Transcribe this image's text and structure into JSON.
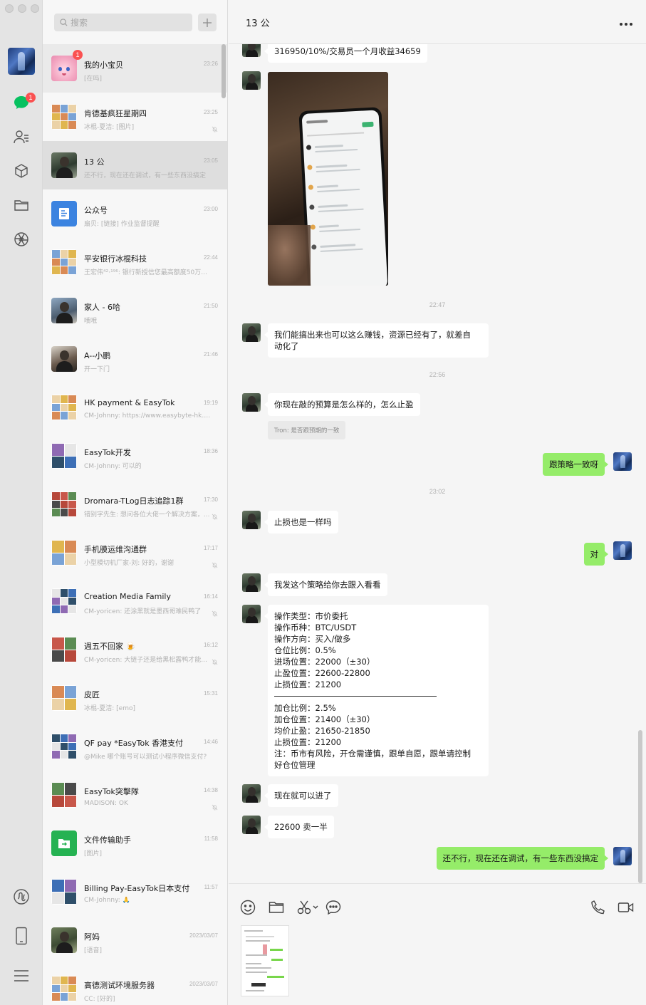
{
  "iconbar": {
    "chat_badge": "1"
  },
  "search": {
    "placeholder": "搜索"
  },
  "chats": [
    {
      "name": "我的小宝贝",
      "preview": "[在吗]",
      "time": "23:26",
      "badge": "1",
      "muted": false,
      "avatar": "pink-character"
    },
    {
      "name": "肯德基疯狂星期四",
      "preview": "冰棍-夏洁: [图片]",
      "time": "23:25",
      "muted": true,
      "avatar": "group"
    },
    {
      "name": "13 公",
      "preview": "还不行，现在还在调试，有一些东西没搞定",
      "time": "23:05",
      "muted": false,
      "avatar": "person"
    },
    {
      "name": "公众号",
      "preview": "扇贝: [链接] 作业监督提醒",
      "time": "23:00",
      "muted": false,
      "avatar": "official"
    },
    {
      "name": "平安银行冰棍科技",
      "preview": "王宏伟⁴²·¹⁹⁶: 银行新授信您最高额度50万...",
      "time": "22:44",
      "muted": false,
      "avatar": "group"
    },
    {
      "name": "家人 - 6哈",
      "preview": "哦哦",
      "time": "21:50",
      "muted": false,
      "avatar": "person2"
    },
    {
      "name": "A--小鹏",
      "preview": "开一下门",
      "time": "21:46",
      "muted": false,
      "avatar": "person3"
    },
    {
      "name": "HK payment & EasyTok",
      "preview": "CM-Johnny: https://www.easybyte-hk.co...",
      "time": "19:19",
      "muted": false,
      "avatar": "group"
    },
    {
      "name": "EasyTok开发",
      "preview": "CM-Johnny: 可以的",
      "time": "18:36",
      "muted": false,
      "avatar": "group2"
    },
    {
      "name": "Dromara-TLog日志追踪1群",
      "preview": "错别字先生: 想问各位大佬一个解决方案，...",
      "time": "17:30",
      "muted": true,
      "avatar": "group"
    },
    {
      "name": "手机膜运维沟通群",
      "preview": "小型模切机厂家-刘: 好的，谢谢",
      "time": "17:17",
      "muted": true,
      "avatar": "group2"
    },
    {
      "name": "Creation Media Family",
      "preview": "CM-yoricen: 还涂黑就是墨西哥难民鸭了",
      "time": "16:14",
      "muted": true,
      "avatar": "group"
    },
    {
      "name": "週五不回家 🍺",
      "preview": "CM-yoricen: 大链子还是给黑松露鸭才能...",
      "time": "16:12",
      "muted": true,
      "avatar": "group2"
    },
    {
      "name": "皮匠",
      "preview": "冰棍-夏洁: [emo]",
      "time": "15:31",
      "muted": false,
      "avatar": "group2"
    },
    {
      "name": "QF pay *EasyTok 香港支付",
      "preview": "@Mike 哪个账号可以测试小程序微信支付?",
      "time": "14:46",
      "muted": false,
      "avatar": "group"
    },
    {
      "name": "EasyTok突擊隊",
      "preview": "MADISON: OK",
      "time": "14:38",
      "muted": true,
      "avatar": "group2"
    },
    {
      "name": "文件传输助手",
      "preview": "[图片]",
      "time": "11:58",
      "muted": false,
      "avatar": "file"
    },
    {
      "name": "Billing Pay-EasyTok日本支付",
      "preview": "CM-Johnny: 🙏",
      "time": "11:57",
      "muted": false,
      "avatar": "group2"
    },
    {
      "name": "阿妈",
      "preview": "[语音]",
      "time": "2023/03/07",
      "muted": false,
      "avatar": "person4"
    },
    {
      "name": "高德测试环境服务器",
      "preview": "CC: [好的]",
      "time": "2023/03/07",
      "muted": false,
      "avatar": "group"
    }
  ],
  "chat": {
    "title": "13 公",
    "m0": "316950/10%/交易员一个月收益34659",
    "t1": "22:47",
    "m2": "我们能搞出来也可以这么赚钱，资源已经有了，就差自\n动化了",
    "t2": "22:56",
    "m3": "你现在敲的预算是怎么样的，怎么止盈",
    "quote": "Tron: 是否跟预期的一致",
    "m4": "跟策略一致呀",
    "t3": "23:02",
    "m5": "止损也是一样吗",
    "m6": "对",
    "m7": "我发这个策略给你去跟入看看",
    "s1": [
      "操作类型：市价委托",
      "操作币种：BTC/USDT",
      "操作方向：买入/做多",
      "仓位比例：0.5%",
      "进场位置：22000（±30）",
      "止盈位置：22600-22800",
      "止损位置：21200"
    ],
    "s2": [
      "加仓比例：2.5%",
      "加仓位置：21400（±30）",
      "均价止盈：21650-21850",
      "止损位置：21200",
      "注：币市有风险，开仓需谨慎，跟单自愿，跟单请控制",
      "好仓位管理"
    ],
    "m9": "现在就可以进了",
    "m10": "22600 卖一半",
    "m11": "还不行，现在还在调试，有一些东西没搞定"
  }
}
